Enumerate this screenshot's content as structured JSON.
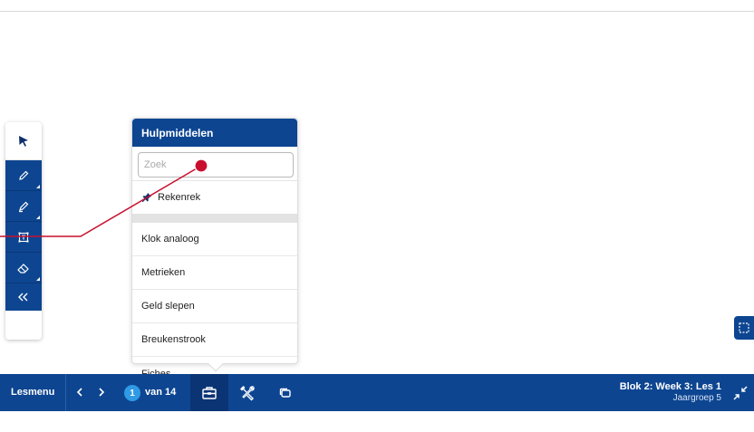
{
  "panel": {
    "title": "Hulpmiddelen",
    "search_placeholder": "Zoek",
    "pinned_label": "Rekenrek",
    "items": [
      {
        "label": "Klok analoog"
      },
      {
        "label": "Metrieken"
      },
      {
        "label": "Geld slepen"
      },
      {
        "label": "Breukenstrook"
      },
      {
        "label": "Fiches"
      }
    ]
  },
  "toolbar": {
    "tools": [
      "pointer-icon",
      "pencil-icon",
      "marker-icon",
      "text-box-icon",
      "eraser-icon",
      "collapse-left-icon"
    ]
  },
  "bottombar": {
    "lesmenu_label": "Lesmenu",
    "current_page": "1",
    "page_total": "van 14",
    "lesson_title": "Blok 2: Week 3: Les 1",
    "lesson_group": "Jaargroep 5"
  },
  "colors": {
    "primary": "#0d4591",
    "badge": "#2f9ae6",
    "pointer": "#c8102e"
  }
}
